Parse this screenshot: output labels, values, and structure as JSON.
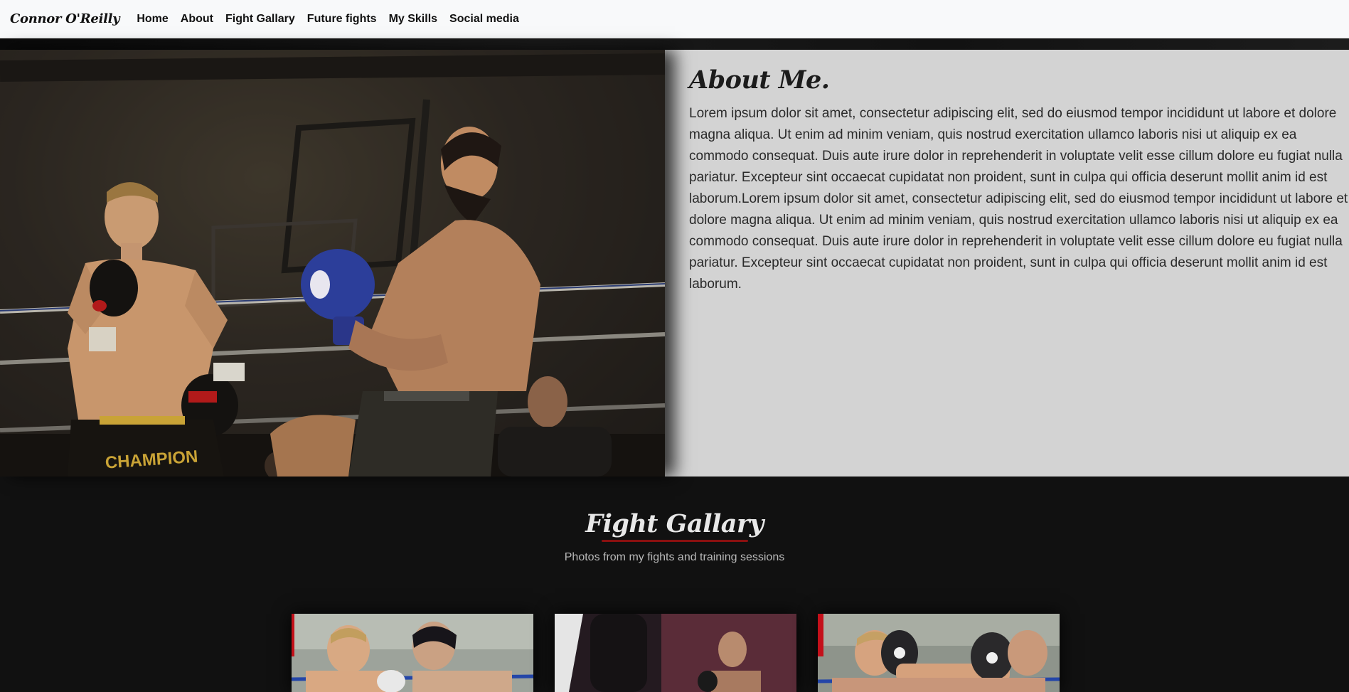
{
  "navbar": {
    "brand": "Connor O'Reilly",
    "links": [
      "Home",
      "About",
      "Fight Gallary",
      "Future fights",
      "My Skills",
      "Social media"
    ]
  },
  "about": {
    "title": "About Me.",
    "body": "Lorem ipsum dolor sit amet, consectetur adipiscing elit, sed do eiusmod tempor incididunt ut labore et dolore magna aliqua. Ut enim ad minim veniam, quis nostrud exercitation ullamco laboris nisi ut aliquip ex ea commodo consequat. Duis aute irure dolor in reprehenderit in voluptate velit esse cillum dolore eu fugiat nulla pariatur. Excepteur sint occaecat cupidatat non proident, sunt in culpa qui officia deserunt mollit anim id est laborum.Lorem ipsum dolor sit amet, consectetur adipiscing elit, sed do eiusmod tempor incididunt ut labore et dolore magna aliqua. Ut enim ad minim veniam, quis nostrud exercitation ullamco laboris nisi ut aliquip ex ea commodo consequat. Duis aute irure dolor in reprehenderit in voluptate velit esse cillum dolore eu fugiat nulla pariatur. Excepteur sint occaecat cupidatat non proident, sunt in culpa qui officia deserunt mollit anim id est laborum."
  },
  "hero_photo": {
    "shorts_text": "CHAMPION"
  },
  "gallery": {
    "title": "Fight Gallary",
    "subtitle": "Photos from my fights and training sessions"
  },
  "colors": {
    "navbar_bg": "#f8f9fa",
    "about_bg": "#d3d3d3",
    "page_bg": "#111111",
    "accent_underline": "#8b1010"
  }
}
